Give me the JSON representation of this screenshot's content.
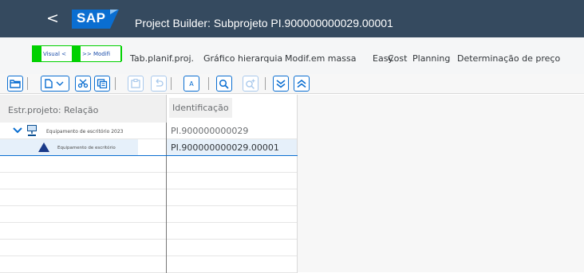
{
  "header": {
    "back_label": "<",
    "logo_text": "SAP",
    "title": "Project Builder: Subprojeto PI.900000000029.00001",
    "logo_color": "#0a6ed1",
    "shell_color": "#354a5f"
  },
  "menu": {
    "visual_label": "Visual <",
    "modify_label": ">> Modifi",
    "items": [
      "Tab.planif.proj.",
      "Gráfico hierarquia",
      "Modif.em massa",
      "Easy",
      "Cost",
      "Planning",
      "Determinação de preço"
    ]
  },
  "toolbar": {
    "buttons": [
      "open-folder-icon",
      "new-document-dropdown-icon",
      "cut-icon",
      "copy-icon",
      "paste-icon",
      "undo-icon",
      "text-icon",
      "find-icon",
      "find-next-icon",
      "expand-all-icon",
      "collapse-all-icon"
    ]
  },
  "table": {
    "col_structure": "Estr.projeto: Relação",
    "col_identification": "Identificação",
    "rows": [
      {
        "level": 0,
        "expand": "⌵",
        "label": "Equipamento de escritório 2023",
        "id": "PI.900000000029",
        "selected": false
      },
      {
        "level": 1,
        "expand": "",
        "label": "Equipamento de escritório",
        "id": "PI.900000000029.00001",
        "selected": true
      }
    ],
    "empty_rows": 7
  }
}
